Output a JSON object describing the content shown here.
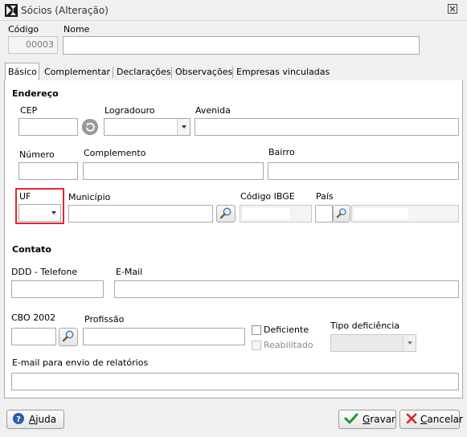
{
  "window": {
    "title": "Sócios (Alteração)",
    "close_glyph": "⊠"
  },
  "header": {
    "codigo_label": "Código",
    "codigo_value": "00003",
    "nome_label": "Nome",
    "nome_value": ""
  },
  "tabs": [
    {
      "label": "Básico",
      "active": true
    },
    {
      "label": "Complementar"
    },
    {
      "label": "Declarações"
    },
    {
      "label": "Observações"
    },
    {
      "label": "Empresas vinculadas"
    }
  ],
  "endereco": {
    "section_title": "Endereço",
    "cep_label": "CEP",
    "logradouro_label": "Logradouro",
    "avenida_label": "Avenida",
    "numero_label": "Número",
    "complemento_label": "Complemento",
    "bairro_label": "Bairro",
    "uf_label": "UF",
    "municipio_label": "Município",
    "codigo_ibge_label": "Código IBGE",
    "pais_label": "País"
  },
  "contato": {
    "section_title": "Contato",
    "ddd_telefone_label": "DDD - Telefone",
    "email_label": "E-Mail",
    "cbo_label": "CBO 2002",
    "profissao_label": "Profissão",
    "deficiente_label": "Deficiente",
    "reabilitado_label": "Reabilitado",
    "tipo_deficiencia_label": "Tipo deficiência",
    "email_relatorios_label": "E-mail para envio de relatórios"
  },
  "footer": {
    "ajuda_prefix": "",
    "ajuda_mnemonic": "A",
    "ajuda_rest": "juda",
    "gravar_mnemonic": "G",
    "gravar_rest": "ravar",
    "cancelar_mnemonic": "C",
    "cancelar_rest": "ancelar"
  },
  "colors": {
    "highlight": "#e0282e",
    "gravar_check": "#1e9a2a",
    "cancelar_x": "#d42a2a",
    "help_icon": "#2a5db0"
  },
  "icons": [
    "app-logo-icon",
    "close-icon",
    "refresh-icon",
    "search-icon",
    "help-icon",
    "check-icon",
    "cancel-x-icon",
    "dropdown-arrow-icon"
  ]
}
